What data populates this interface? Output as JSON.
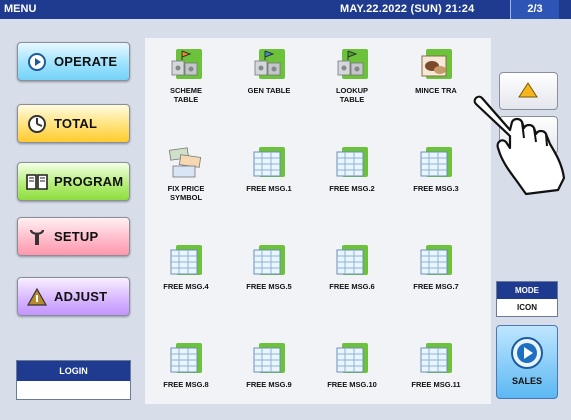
{
  "header": {
    "title": "MENU",
    "datetime": "MAY.22.2022 (SUN)  21:24",
    "page_indicator": "2/3"
  },
  "nav": [
    {
      "label": "OPERATE",
      "icon": "play-circle-icon"
    },
    {
      "label": "TOTAL",
      "icon": "clock-icon"
    },
    {
      "label": "PROGRAM",
      "icon": "book-icon"
    },
    {
      "label": "SETUP",
      "icon": "wrench-icon"
    },
    {
      "label": "ADJUST",
      "icon": "adjust-icon"
    }
  ],
  "login": {
    "label": "LOGIN"
  },
  "tiles": [
    {
      "line1": "SCHEME",
      "line2": "TABLE",
      "icon": "scheme-table-icon"
    },
    {
      "line1": "GEN TABLE",
      "line2": "",
      "icon": "gen-table-icon"
    },
    {
      "line1": "LOOKUP",
      "line2": "TABLE",
      "icon": "lookup-table-icon"
    },
    {
      "line1": "MINCE TRA",
      "line2": "",
      "icon": "mince-trace-icon"
    },
    {
      "line1": "FIX PRICE",
      "line2": "SYMBOL",
      "icon": "fix-price-icon"
    },
    {
      "line1": "FREE MSG.1",
      "line2": "",
      "icon": "free-msg-icon"
    },
    {
      "line1": "FREE MSG.2",
      "line2": "",
      "icon": "free-msg-icon"
    },
    {
      "line1": "FREE MSG.3",
      "line2": "",
      "icon": "free-msg-icon"
    },
    {
      "line1": "FREE MSG.4",
      "line2": "",
      "icon": "free-msg-icon"
    },
    {
      "line1": "FREE MSG.5",
      "line2": "",
      "icon": "free-msg-icon"
    },
    {
      "line1": "FREE MSG.6",
      "line2": "",
      "icon": "free-msg-icon"
    },
    {
      "line1": "FREE MSG.7",
      "line2": "",
      "icon": "free-msg-icon"
    },
    {
      "line1": "FREE MSG.8",
      "line2": "",
      "icon": "free-msg-icon"
    },
    {
      "line1": "FREE MSG.9",
      "line2": "",
      "icon": "free-msg-icon"
    },
    {
      "line1": "FREE MSG.10",
      "line2": "",
      "icon": "free-msg-icon"
    },
    {
      "line1": "FREE MSG.11",
      "line2": "",
      "icon": "free-msg-icon"
    }
  ],
  "mode": {
    "label": "MODE",
    "value": "ICON"
  },
  "sales": {
    "label": "SALES",
    "icon": "sales-play-icon"
  },
  "colors": {
    "header_bg": "#1f3b8f",
    "panel_bg": "#f1f3f7",
    "frame_bg": "#d8dee9",
    "tile_green": "#6cc23a"
  }
}
